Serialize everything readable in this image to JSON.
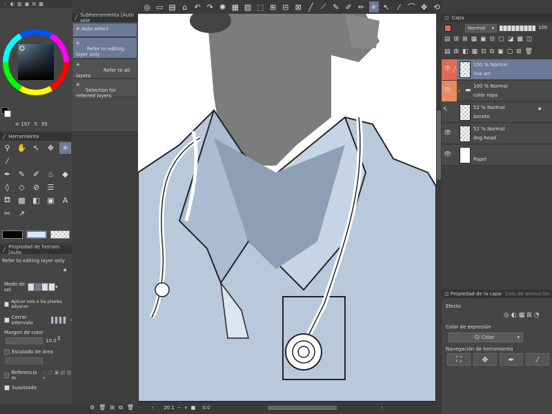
{
  "sub_tool": {
    "header": "Subherramienta [Auto sele",
    "items": [
      "Auto select",
      "Refer to editing layer only",
      "Refer to all layers",
      "Selection for referred layers"
    ]
  },
  "color": {
    "line1": "197",
    "line1_prefix": "≡",
    "mid": "5",
    "right": "95"
  },
  "tool_panel": {
    "header": "Herramienta"
  },
  "tool_prop": {
    "header": "Propiedad de herram. [Auto",
    "subtitle": "Refer to editing layer only",
    "mode_label": "Modo de sel",
    "adjacent_label": "Aplicar solo a los píxeles adyacen",
    "close_gap_label": "Cerrar intervalo",
    "color_margin_label": "Margen de color",
    "color_margin_value": "10.0",
    "area_scale_label": "Escalado de área",
    "reference_label": "Referencia m",
    "smooth_label": "Suavizado"
  },
  "layers": {
    "header": "Capa",
    "blend_mode": "Normal",
    "opacity": "100",
    "items": [
      {
        "pct": "100 % Normal",
        "name": "line art"
      },
      {
        "pct": "100 % Normal",
        "name": "color ropa"
      },
      {
        "pct": "52 % Normal",
        "name": "boceto"
      },
      {
        "pct": "52 % Normal",
        "name": "dog head"
      },
      {
        "pct": "",
        "name": "Papel"
      }
    ]
  },
  "layer_prop": {
    "tab1": "Propiedad de la capa",
    "tab2": "Cola de animación",
    "effect_label": "Efecto",
    "expression_label": "Color de expresión",
    "expression_value": "Color",
    "nav_label": "Navegación de herramienta"
  },
  "canvas": {
    "zoom": "20.1",
    "angle": "0.0"
  },
  "colors": {
    "accent": "#6b7a96",
    "layer_red": "#e26a55",
    "layer_orange": "#e98a62"
  }
}
